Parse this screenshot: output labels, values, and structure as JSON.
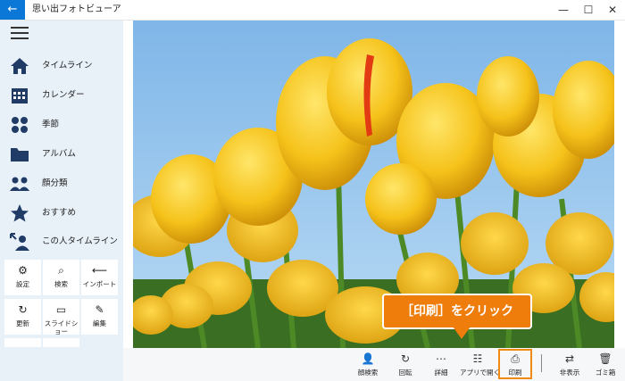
{
  "titlebar": {
    "app_title": "思い出フォトビューア",
    "back_icon": "←",
    "minimize_icon": "—",
    "maximize_icon": "☐",
    "close_icon": "✕",
    "accent_color": "#0b78d7"
  },
  "sidebar": {
    "nav_items": [
      {
        "label": "タイムライン",
        "icon": "home-icon"
      },
      {
        "label": "カレンダー",
        "icon": "calendar-icon"
      },
      {
        "label": "季節",
        "icon": "season-icon"
      },
      {
        "label": "アルバム",
        "icon": "folder-icon"
      },
      {
        "label": "顔分類",
        "icon": "faces-icon"
      },
      {
        "label": "おすすめ",
        "icon": "star-icon"
      },
      {
        "label": "この人タイムライン",
        "icon": "person-timeline-icon"
      }
    ],
    "tiles": [
      {
        "label": "設定",
        "icon": "⚙"
      },
      {
        "label": "検索",
        "icon": "⌕"
      },
      {
        "label": "インポート",
        "icon": "⟵"
      },
      {
        "label": "更新",
        "icon": "↻"
      },
      {
        "label": "スライドショー",
        "icon": "▭"
      },
      {
        "label": "編集",
        "icon": "✎"
      }
    ]
  },
  "bottombar": {
    "buttons": [
      {
        "label": "顔検索",
        "icon": "👤"
      },
      {
        "label": "回転",
        "icon": "↻"
      },
      {
        "label": "詳細",
        "icon": "⋯"
      },
      {
        "label": "アプリで開く",
        "icon": "☷"
      },
      {
        "label": "印刷",
        "icon": "⎙"
      },
      {
        "label": "非表示",
        "icon": "⇄"
      },
      {
        "label": "ゴミ箱",
        "icon": "🗑"
      }
    ]
  },
  "callout": {
    "text": "［印刷］をクリック",
    "color": "#ee7d0c"
  }
}
